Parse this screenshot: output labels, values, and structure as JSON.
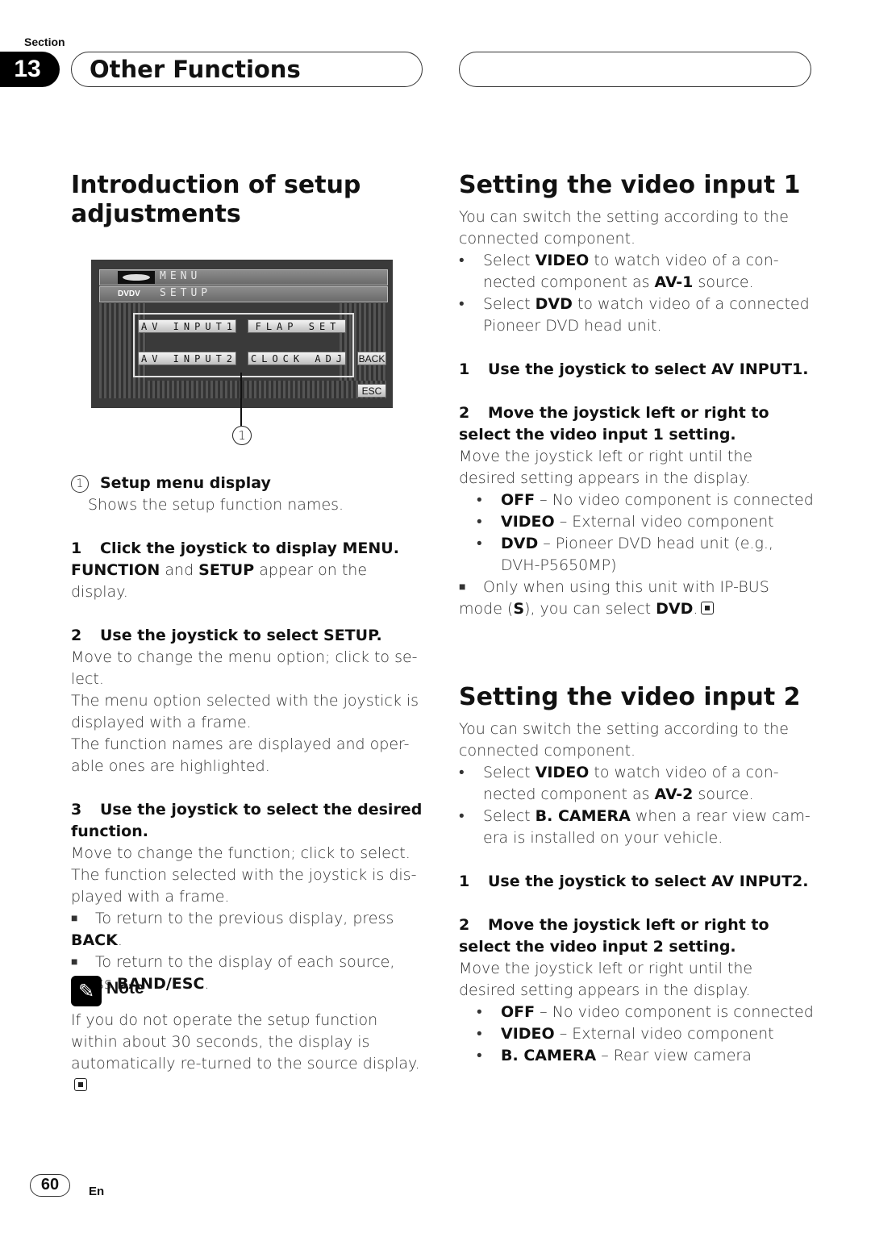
{
  "header": {
    "section_label": "Section",
    "section_number": "13",
    "section_title": "Other Functions"
  },
  "left": {
    "title": "Introduction of setup adjustments",
    "screen": {
      "menu_label": "MENU",
      "source_label": "DVDV",
      "setup_label": "SETUP",
      "buttons": [
        "AV INPUT1",
        "FLAP SET",
        "AV INPUT2",
        "CLOCK ADJ"
      ],
      "back_label": "BACK",
      "esc_label": "ESC"
    },
    "callout_number": "1",
    "callout_title": "Setup menu display",
    "callout_desc": "Shows the setup function names.",
    "step1_num": "1",
    "step1_title": "Click the joystick to display MENU.",
    "step1_b1": "FUNCTION",
    "step1_t1": " and ",
    "step1_b2": "SETUP",
    "step1_t2": " appear on the display.",
    "step2_num": "2",
    "step2_title": "Use the joystick to select SETUP.",
    "step2_p1": "Move to change the menu option; click to se-lect.",
    "step2_p2": "The menu option selected with the joystick is displayed with a frame.",
    "step2_p3": "The function names are displayed and oper-able ones are highlighted.",
    "step3_num": "3",
    "step3_title": "Use the joystick to select the desired function.",
    "step3_p1": "Move to change the function; click to select. The function selected with the joystick is dis-played with a frame.",
    "tip1_text": "To return to the previous display, press ",
    "tip1_bold": "BACK",
    "tip2_text": "To return to the display of each source, press ",
    "tip2_bold": "BAND/ESC",
    "note_title": "Note",
    "note_text": "If you do not operate the setup function within about 30 seconds, the display is automatically re-turned to the source display."
  },
  "right": {
    "v1": {
      "title": "Setting the video input 1",
      "intro": "You can switch the setting according to the connected component.",
      "b1_pre": "Select ",
      "b1_bold": "VIDEO",
      "b1_mid": " to watch video of a con-nected component as ",
      "b1_bold2": "AV-1",
      "b1_post": " source.",
      "b2_pre": "Select ",
      "b2_bold": "DVD",
      "b2_post": " to watch video of a connected Pioneer DVD head unit.",
      "step1_num": "1",
      "step1_title": "Use the joystick to select AV INPUT1.",
      "step2_num": "2",
      "step2_title": "Move the joystick left or right to select the video input 1 setting.",
      "step2_desc": "Move the joystick left or right until the desired setting appears in the display.",
      "options": [
        {
          "name": "OFF",
          "desc": " – No video component is connected"
        },
        {
          "name": "VIDEO",
          "desc": " – External video component"
        },
        {
          "name": "DVD",
          "desc": " – Pioneer DVD head unit (e.g., DVH-P5650MP)"
        }
      ],
      "tip_pre": "Only when using this unit with IP-BUS mode (",
      "tip_bold": "S",
      "tip_mid": "), you can select ",
      "tip_bold2": "DVD",
      "tip_post": "."
    },
    "v2": {
      "title": "Setting the video input 2",
      "intro": "You can switch the setting according to the connected component.",
      "b1_pre": "Select ",
      "b1_bold": "VIDEO",
      "b1_mid": " to watch video of a con-nected component as ",
      "b1_bold2": "AV-2",
      "b1_post": " source.",
      "b2_pre": "Select ",
      "b2_bold": "B. CAMERA",
      "b2_post": " when a rear view cam-era is installed on your vehicle.",
      "step1_num": "1",
      "step1_title": "Use the joystick to select AV INPUT2.",
      "step2_num": "2",
      "step2_title": "Move the joystick left or right to select the video input 2 setting.",
      "step2_desc": "Move the joystick left or right until the desired setting appears in the display.",
      "options": [
        {
          "name": "OFF",
          "desc": " – No video component is connected"
        },
        {
          "name": "VIDEO",
          "desc": " – External video component"
        },
        {
          "name": "B. CAMERA",
          "desc": " – Rear view camera"
        }
      ]
    }
  },
  "footer": {
    "page_number": "60",
    "language": "En"
  }
}
